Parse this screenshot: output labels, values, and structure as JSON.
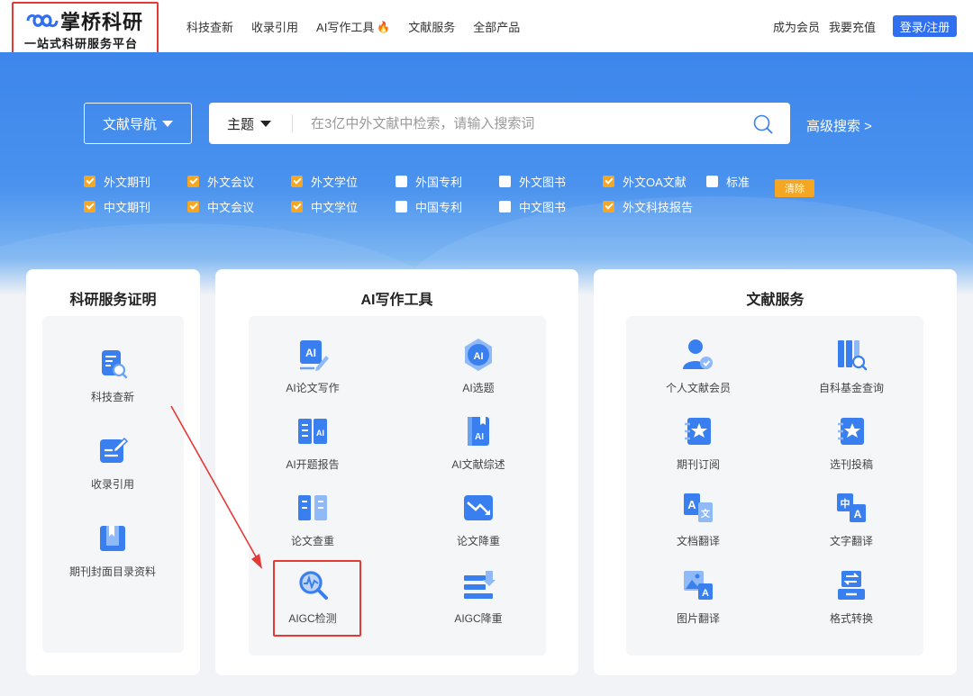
{
  "brand": {
    "name": "掌桥科研",
    "tagline": "一站式科研服务平台"
  },
  "nav": {
    "items": [
      "科技查新",
      "收录引用",
      "AI写作工具",
      "文献服务",
      "全部产品"
    ],
    "right": [
      "成为会员",
      "我要充值"
    ],
    "login": "登录/注册"
  },
  "search": {
    "guide": "文献导航",
    "type": "主题",
    "placeholder": "在3亿中外文献中检索，请输入搜索词",
    "advanced": "高级搜索 >"
  },
  "filters": {
    "row1": [
      {
        "label": "外文期刊",
        "checked": true
      },
      {
        "label": "外文会议",
        "checked": true
      },
      {
        "label": "外文学位",
        "checked": true
      },
      {
        "label": "外国专利",
        "checked": false
      },
      {
        "label": "外文图书",
        "checked": false
      },
      {
        "label": "外文OA文献",
        "checked": true
      },
      {
        "label": "标准",
        "checked": false
      }
    ],
    "row2": [
      {
        "label": "中文期刊",
        "checked": true
      },
      {
        "label": "中文会议",
        "checked": true
      },
      {
        "label": "中文学位",
        "checked": true
      },
      {
        "label": "中国专利",
        "checked": false
      },
      {
        "label": "中文图书",
        "checked": false
      },
      {
        "label": "外文科技报告",
        "checked": true
      }
    ],
    "clear": "清除"
  },
  "panels": {
    "research": {
      "title": "科研服务证明",
      "items": [
        "科技查新",
        "收录引用",
        "期刊封面目录资料"
      ]
    },
    "ai": {
      "title": "AI写作工具",
      "items": [
        "AI论文写作",
        "AI选题",
        "AI开题报告",
        "AI文献综述",
        "论文查重",
        "论文降重",
        "AIGC检测",
        "AIGC降重"
      ]
    },
    "literature": {
      "title": "文献服务",
      "items": [
        "个人文献会员",
        "自科基金查询",
        "期刊订阅",
        "选刊投稿",
        "文档翻译",
        "文字翻译",
        "图片翻译",
        "格式转换"
      ]
    }
  },
  "colors": {
    "primary": "#2f6ff0",
    "accent": "#f5a623",
    "highlight": "#e53935",
    "icon": "#3a7ff0"
  }
}
